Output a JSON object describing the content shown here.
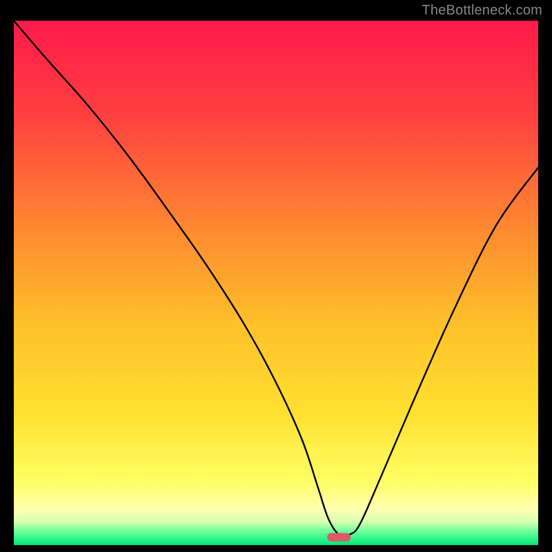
{
  "watermark": "TheBottleneck.com",
  "chart_data": {
    "type": "line",
    "title": "",
    "xlabel": "",
    "ylabel": "",
    "xlim": [
      0,
      100
    ],
    "ylim": [
      0,
      100
    ],
    "grid": false,
    "legend": false,
    "background": {
      "description": "vertical gradient from red (top) through orange/yellow to soft-yellow, then narrow green band at bottom",
      "stops": [
        {
          "offset": 0.0,
          "color": "#ff1a4b"
        },
        {
          "offset": 0.18,
          "color": "#ff4040"
        },
        {
          "offset": 0.4,
          "color": "#ff8a30"
        },
        {
          "offset": 0.58,
          "color": "#ffc02a"
        },
        {
          "offset": 0.75,
          "color": "#ffe030"
        },
        {
          "offset": 0.88,
          "color": "#ffff66"
        },
        {
          "offset": 0.93,
          "color": "#ffffb0"
        },
        {
          "offset": 0.955,
          "color": "#d8ffb0"
        },
        {
          "offset": 0.975,
          "color": "#66ff99"
        },
        {
          "offset": 1.0,
          "color": "#00e676"
        }
      ]
    },
    "series": [
      {
        "name": "bottleneck-curve",
        "color": "#000000",
        "stroke_width": 2.4,
        "x": [
          0,
          6,
          14,
          22,
          30,
          37,
          44,
          50,
          55,
          58,
          60,
          62,
          64,
          66,
          70,
          76,
          84,
          92,
          100
        ],
        "y": [
          100,
          93,
          84,
          74,
          63,
          53,
          42,
          31,
          20,
          11,
          5,
          2,
          2,
          4,
          13,
          27,
          45,
          61,
          72
        ]
      }
    ],
    "annotations": [
      {
        "name": "optimal-marker",
        "shape": "capsule",
        "x": 62,
        "y": 1.5,
        "width_pct": 4.5,
        "height_pct": 1.6,
        "color": "#d95a6a"
      }
    ]
  }
}
